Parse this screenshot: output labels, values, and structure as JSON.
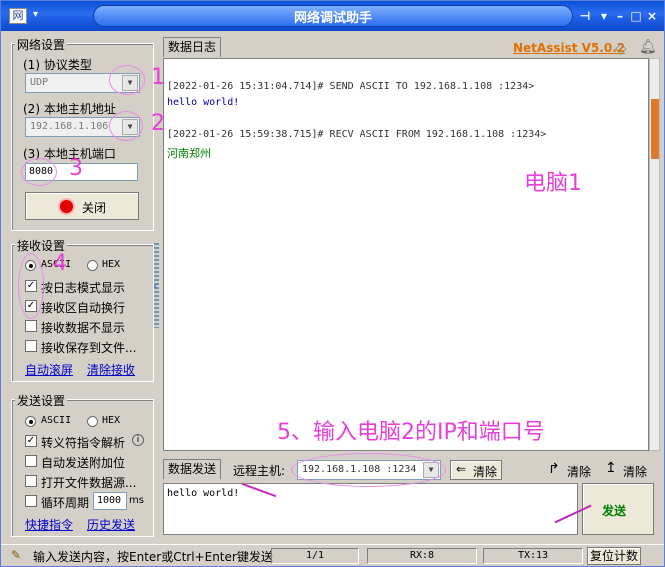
{
  "window": {
    "title": "网络调试助手",
    "sys_menu": "▾",
    "app_icon": "网"
  },
  "brand": {
    "name": "NetAssist V5.0.2",
    "color": "#e07000"
  },
  "network": {
    "group_title": "网络设置",
    "protocol_label": "(1) 协议类型",
    "protocol_value": "UDP",
    "host_label": "(2) 本地主机地址",
    "host_value": "192.168.1.106",
    "port_label": "(3) 本地主机端口",
    "port_value": "8080",
    "close_button": "关闭"
  },
  "receive": {
    "group_title": "接收设置",
    "ascii": "ASCII",
    "hex": "HEX",
    "options": [
      "按日志模式显示",
      "接收区自动换行",
      "接收数据不显示",
      "接收保存到文件..."
    ],
    "auto_clear": "自动滚屏",
    "clear_recv": "清除接收"
  },
  "send": {
    "group_title": "发送设置",
    "ascii": "ASCII",
    "hex": "HEX",
    "options": [
      "转义符指令解析",
      "自动发送附加位",
      "打开文件数据源...",
      "循环周期"
    ],
    "period_value": "1000",
    "period_unit": "ms",
    "shortcut": "快捷指令",
    "history": "历史发送"
  },
  "log": {
    "tab": "数据日志",
    "lines": [
      {
        "text": "[2022-01-26 15:31:04.714]# SEND ASCII TO 192.168.1.108 :1234>",
        "color": "#333333"
      },
      {
        "text": "hello world!",
        "color": "#0000a0"
      },
      {
        "text": "[2022-01-26 15:59:38.715]# RECV ASCII FROM 192.168.1.108 :1234>",
        "color": "#333333"
      },
      {
        "text": "河南郑州",
        "color": "#008000"
      }
    ]
  },
  "sendbar": {
    "tab": "数据发送",
    "remote_label": "远程主机:",
    "remote_value": "192.168.1.108 :1234",
    "clear1": "清除",
    "clear2": "清除",
    "clear3": "清除",
    "send_text": "hello world!",
    "send_button": "发送"
  },
  "annotations": {
    "n1": "1",
    "n2": "2",
    "n3": "3",
    "n4": "4",
    "pc1": "电脑1",
    "step5": "5、输入电脑2的IP和端口号"
  },
  "status": {
    "hint": "输入发送内容，按Enter或Ctrl+Enter键发送",
    "page": "1/1",
    "rx": "RX:8",
    "tx": "TX:13",
    "reset": "复位计数"
  }
}
